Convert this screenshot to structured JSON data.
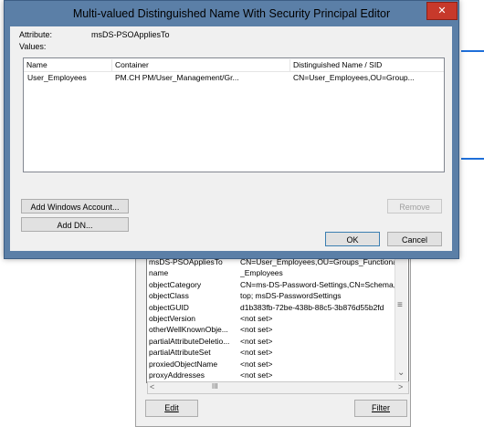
{
  "dialog": {
    "title": "Multi-valued Distinguished Name With Security Principal Editor",
    "close_glyph": "✕",
    "attribute_label": "Attribute:",
    "attribute_value": "msDS-PSOAppliesTo",
    "values_label": "Values:",
    "columns": [
      "Name",
      "Container",
      "Distinguished Name / SID"
    ],
    "row": {
      "name": "User_Employees",
      "container": "PM.CH    PM/User_Management/Gr...",
      "dn": "CN=User_Employees,OU=Group..."
    },
    "add_windows_account": "Add Windows Account...",
    "add_dn": "Add DN...",
    "remove": "Remove",
    "ok": "OK",
    "cancel": "Cancel"
  },
  "properties": {
    "rows": [
      {
        "name": "msDS-PSOAppliesTo",
        "value": "CN=User_Employees,OU=Groups_Functiona"
      },
      {
        "name": "name",
        "value": "_Employees"
      },
      {
        "name": "objectCategory",
        "value": "CN=ms-DS-Password-Settings,CN=Schema,C"
      },
      {
        "name": "objectClass",
        "value": "top; msDS-PasswordSettings"
      },
      {
        "name": "objectGUID",
        "value": "d1b383fb-72be-438b-88c5-3b876d55b2fd"
      },
      {
        "name": "objectVersion",
        "value": "<not set>"
      },
      {
        "name": "otherWellKnownObje...",
        "value": "<not set>"
      },
      {
        "name": "partialAttributeDeletio...",
        "value": "<not set>"
      },
      {
        "name": "partialAttributeSet",
        "value": "<not set>"
      },
      {
        "name": "proxiedObjectName",
        "value": "<not set>"
      },
      {
        "name": "proxyAddresses",
        "value": "<not set>"
      }
    ],
    "edit_button": "Edit",
    "filter_button": "Filter",
    "hscroll_mark": "III"
  },
  "icons": {
    "vscroll_mark": "≡",
    "chevron_down": "⌄",
    "chevron_left": "<",
    "chevron_right": ">"
  }
}
